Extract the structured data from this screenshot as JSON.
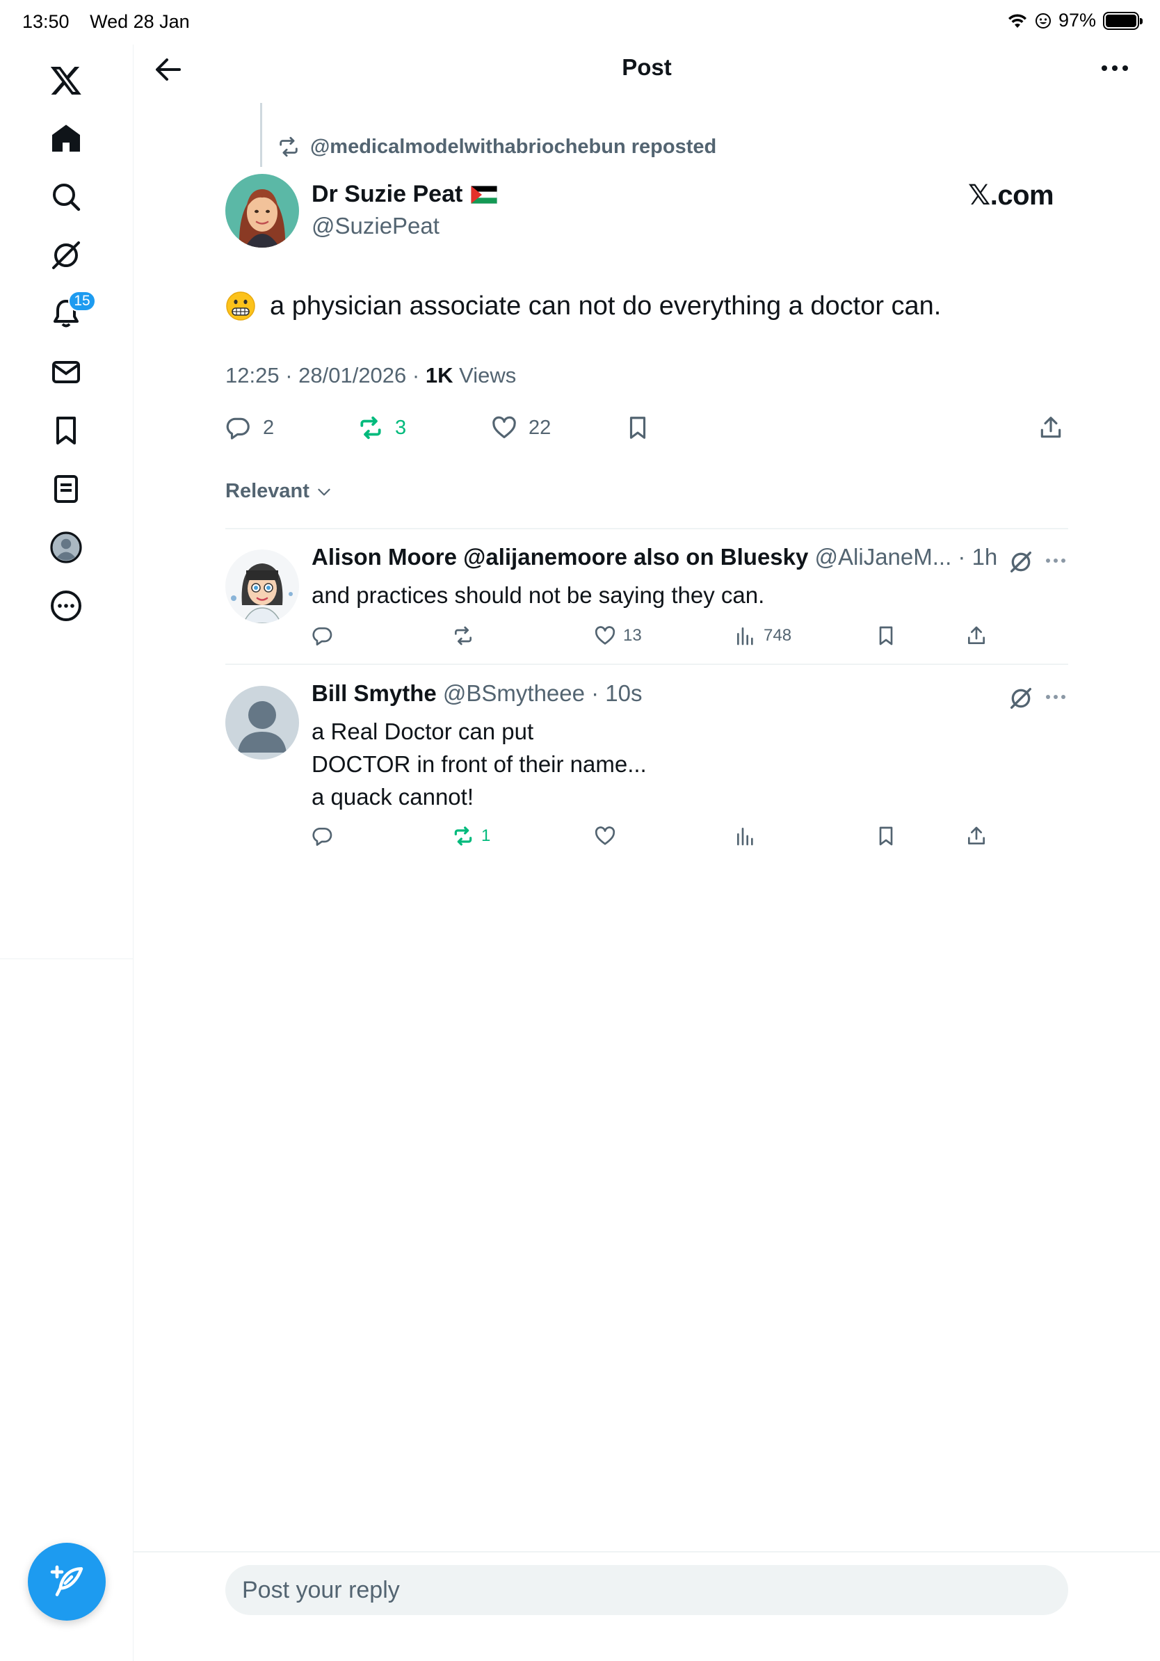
{
  "status_bar": {
    "time": "13:50",
    "date": "Wed 28 Jan",
    "battery": "97%"
  },
  "sidebar": {
    "notifications_badge": "15",
    "items": [
      "x-logo-icon",
      "home-icon",
      "search-icon",
      "grok-icon",
      "notifications-icon",
      "messages-icon",
      "bookmarks-icon",
      "lists-icon",
      "profile-icon",
      "more-icon"
    ]
  },
  "header": {
    "title": "Post"
  },
  "post": {
    "repost_label": "@medicalmodelwithabriochebun reposted",
    "author_name": "Dr Suzie Peat",
    "author_handle": "@SuziePeat",
    "source_label": "𝕏.com",
    "text": "a physician associate can not do everything a doctor can.",
    "meta_time": "12:25 · 28/01/2026 · ",
    "meta_views_count": "1K",
    "meta_views_label": " Views",
    "replies": "2",
    "reposts": "3",
    "likes": "22"
  },
  "sort": {
    "label": "Relevant"
  },
  "replies": [
    {
      "name": "Alison Moore @alijanemoore also on Bluesky",
      "handle_time": " @AliJaneM... · 1h",
      "lines": [
        "and practices should not be saying they can."
      ],
      "reposts": "",
      "likes": "13",
      "views": "748"
    },
    {
      "name": "Bill Smythe",
      "handle_time": " @BSmytheee · 10s",
      "lines": [
        "a Real Doctor can put",
        "DOCTOR in front of their name...",
        "a quack cannot!"
      ],
      "reposts": "1",
      "likes": "",
      "views": ""
    }
  ],
  "composer": {
    "placeholder": "Post your reply"
  },
  "colors": {
    "accent": "#1d9bf0",
    "repost_green": "#00ba7c",
    "secondary_text": "#536471",
    "divider": "#eff3f4"
  }
}
